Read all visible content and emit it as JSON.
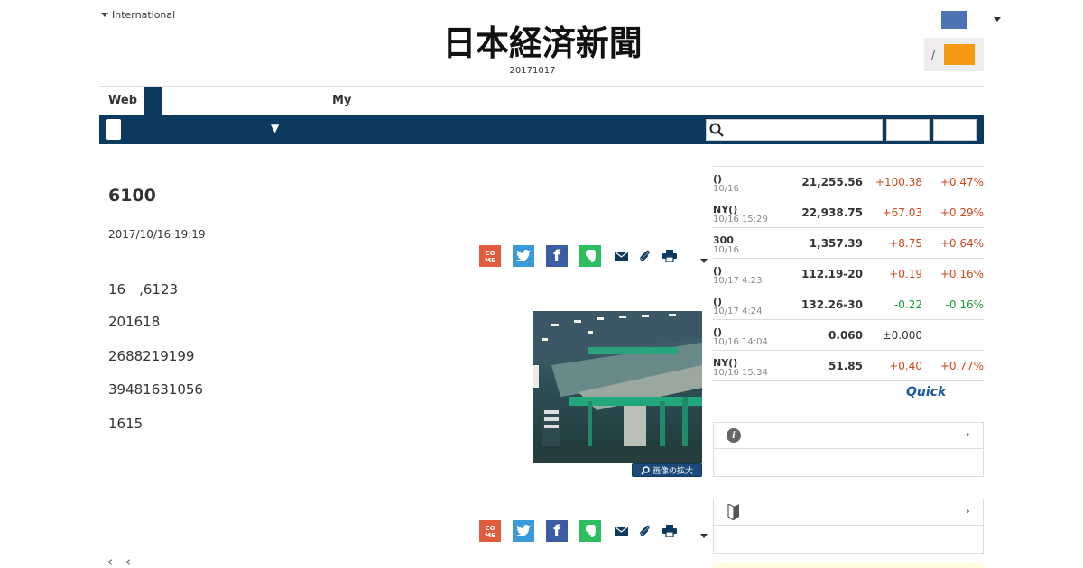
{
  "header": {
    "edition_label": "International",
    "logo_text": "日本経済新聞",
    "date": "20171017",
    "login_separator": "/"
  },
  "tabs": [
    {
      "label": "Web"
    },
    {
      "label": "My"
    }
  ],
  "nav": {
    "dropdown_glyph": "▼",
    "search_placeholder": ""
  },
  "article": {
    "headline": "6100",
    "published": "2017/10/16 19:19",
    "paragraphs": [
      "16　,6123",
      "201618",
      "2688219199",
      "39481631056",
      "1615"
    ],
    "zoom_label": "画像の拡大",
    "pager": [
      "‹",
      "‹"
    ]
  },
  "share": {
    "come_label": "CO\nME",
    "icons": [
      "come-icon",
      "twitter-icon",
      "facebook-icon",
      "evernote-icon",
      "mail-icon",
      "clip-icon",
      "print-icon"
    ]
  },
  "market": {
    "rows": [
      {
        "name": "()",
        "time": "10/16",
        "value": "21,255.56",
        "change": "+100.38",
        "percent": "+0.47%",
        "dir": "up"
      },
      {
        "name": "NY()",
        "time": "10/16 15:29",
        "value": "22,938.75",
        "change": "+67.03",
        "percent": "+0.29%",
        "dir": "up"
      },
      {
        "name": "300",
        "time": "10/16",
        "value": "1,357.39",
        "change": "+8.75",
        "percent": "+0.64%",
        "dir": "up"
      },
      {
        "name": "()",
        "time": "10/17 4:23",
        "value": "112.19-20",
        "change": "+0.19",
        "percent": "+0.16%",
        "dir": "up"
      },
      {
        "name": "()",
        "time": "10/17 4:24",
        "value": "132.26-30",
        "change": "-0.22",
        "percent": "-0.16%",
        "dir": "down"
      },
      {
        "name": "()",
        "time": "10/16 14:04",
        "value": "0.060",
        "change": "±0.000",
        "percent": "",
        "dir": "flat"
      },
      {
        "name": "NY()",
        "time": "10/16 15:34",
        "value": "51.85",
        "change": "+0.40",
        "percent": "+0.77%",
        "dir": "up"
      }
    ],
    "source_logo": "Quick"
  },
  "panels": [
    {
      "icon": "info-icon",
      "chevron": "›"
    },
    {
      "icon": "beginner-mark-icon",
      "chevron": "›"
    }
  ],
  "colors": {
    "nav_bg": "#0c3a5f",
    "up": "#d1461c",
    "down": "#1a9a3a",
    "login_btn": "#f59a12",
    "user_box": "#4d73b5"
  }
}
